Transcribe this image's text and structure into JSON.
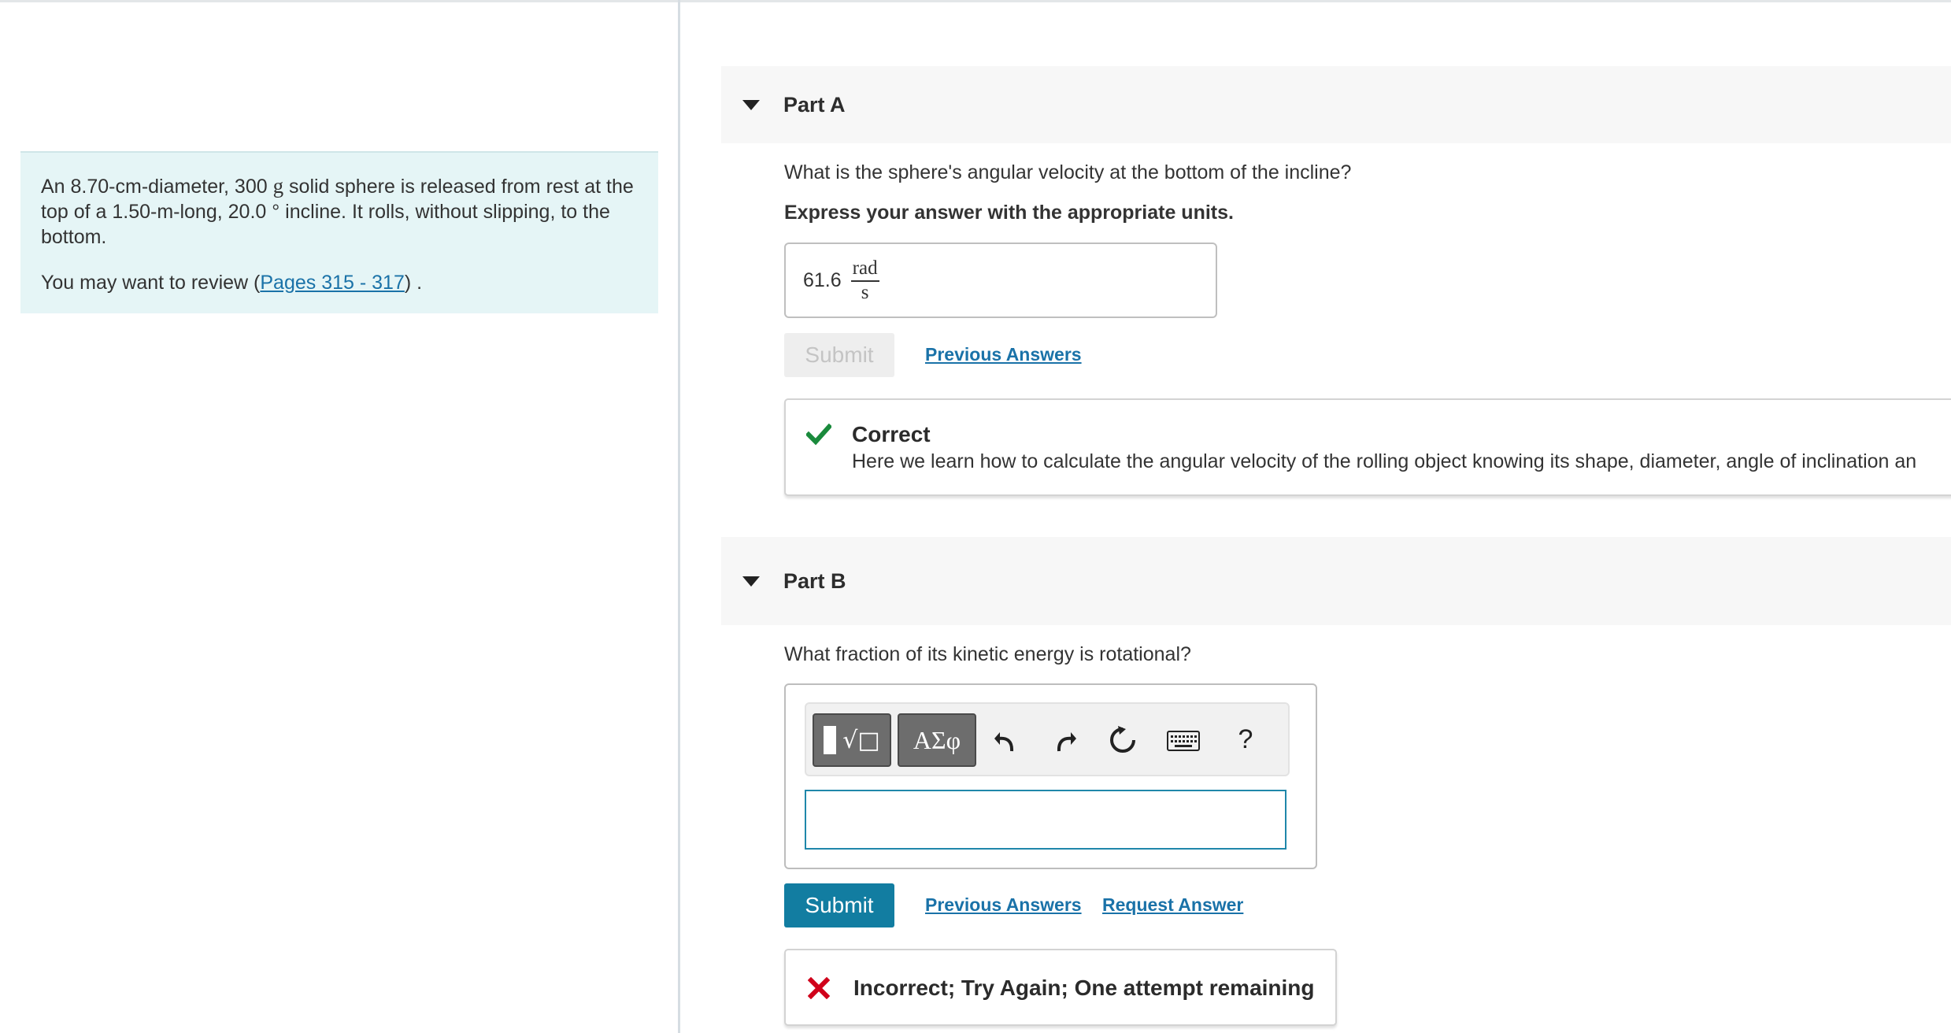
{
  "problem": {
    "text_before": "An 8.70-cm-diameter, 300 ",
    "mass_unit": "g",
    "text_after": " solid sphere is released from rest at the top of a 1.50-m-long, 20.0 ° incline. It rolls, without slipping, to the bottom.",
    "review_prefix": "You may want to review (",
    "review_link": "Pages 315 - 317",
    "review_suffix": ") ."
  },
  "part_a": {
    "title": "Part A",
    "question": "What is the sphere's angular velocity at the bottom of the incline?",
    "instruction": "Express your answer with the appropriate units.",
    "answer_value": "61.6",
    "answer_unit_num": "rad",
    "answer_unit_den": "s",
    "submit_label": "Submit",
    "previous_answers": "Previous Answers",
    "feedback_title": "Correct",
    "feedback_text": "Here we learn how to calculate the angular velocity of the rolling object knowing its shape, diameter, angle of inclination an"
  },
  "part_b": {
    "title": "Part B",
    "question": "What fraction of its kinetic energy is rotational?",
    "toolbar": {
      "templates_label": "√□",
      "symbols_label": "ΑΣφ",
      "help_label": "?"
    },
    "submit_label": "Submit",
    "previous_answers": "Previous Answers",
    "request_answer": "Request Answer",
    "feedback_text": "Incorrect; Try Again; One attempt remaining"
  },
  "colors": {
    "panel_bg": "#e5f5f6",
    "link": "#1a72a8",
    "submit_active": "#127da1",
    "correct_green": "#1a8a3c",
    "incorrect_red": "#d0021b"
  }
}
